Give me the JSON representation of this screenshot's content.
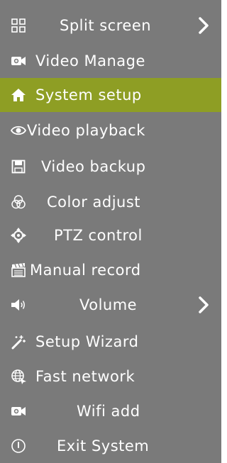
{
  "menu": {
    "items": [
      {
        "label": "Split screen",
        "icon": "split-screen-icon",
        "submenu": true
      },
      {
        "label": "Video Manage",
        "icon": "video-camera-icon"
      },
      {
        "label": "System setup",
        "icon": "home-icon",
        "selected": true
      },
      {
        "label": "Video playback",
        "icon": "eye-icon"
      },
      {
        "label": "Video backup",
        "icon": "floppy-disk-icon"
      },
      {
        "label": "Color adjust",
        "icon": "color-circles-icon"
      },
      {
        "label": "PTZ control",
        "icon": "ptz-arrows-icon"
      },
      {
        "label": "Manual record",
        "icon": "clapperboard-icon"
      },
      {
        "label": "Volume",
        "icon": "speaker-icon",
        "submenu": true
      },
      {
        "label": "Setup Wizard",
        "icon": "magic-wand-icon"
      },
      {
        "label": "Fast network",
        "icon": "globe-network-icon"
      },
      {
        "label": "Wifi add",
        "icon": "video-camera-plus-icon"
      },
      {
        "label": "Exit System",
        "icon": "power-icon"
      }
    ]
  },
  "colors": {
    "background": "#7a7a7a",
    "selected_background": "#8e9e24",
    "text": "#ffffff"
  }
}
